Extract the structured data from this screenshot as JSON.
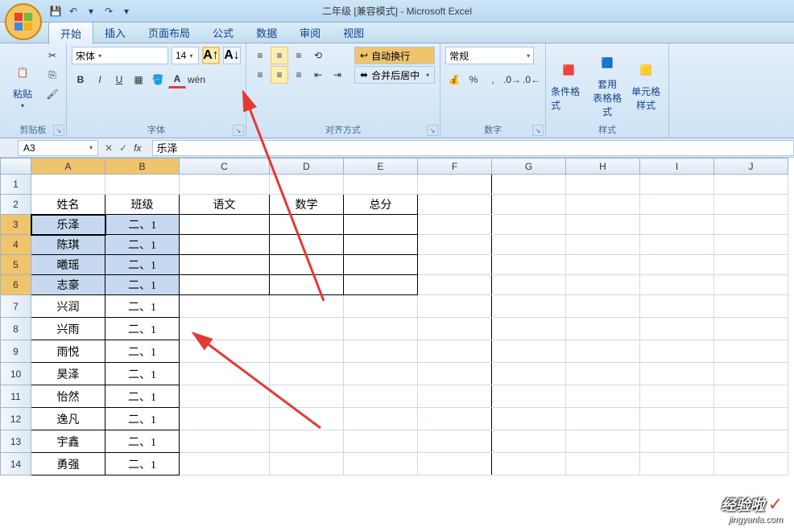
{
  "title": "二年级  [兼容模式] - Microsoft Excel",
  "tabs": {
    "start": "开始",
    "insert": "插入",
    "layout": "页面布局",
    "formula": "公式",
    "data": "数据",
    "review": "审阅",
    "view": "视图"
  },
  "ribbon": {
    "clipboard": {
      "paste": "粘贴",
      "label": "剪贴板"
    },
    "font": {
      "name": "宋体",
      "size": "14",
      "label": "字体"
    },
    "align": {
      "wrap": "自动换行",
      "merge": "合并后居中",
      "label": "对齐方式"
    },
    "number": {
      "format": "常规",
      "label": "数字"
    },
    "styles": {
      "cond": "条件格式",
      "table": "套用\n表格格式",
      "cell": "单元格\n样式",
      "label": "样式"
    }
  },
  "namebox": "A3",
  "formula": "乐泽",
  "cols": [
    "A",
    "B",
    "C",
    "D",
    "E",
    "F",
    "G",
    "H",
    "I",
    "J"
  ],
  "headers": {
    "name": "姓名",
    "class": "班级",
    "chinese": "语文",
    "math": "数学",
    "total": "总分"
  },
  "rows": [
    {
      "n": 3,
      "name": "乐泽",
      "class": "二、1"
    },
    {
      "n": 4,
      "name": "陈琪",
      "class": "二、1"
    },
    {
      "n": 5,
      "name": "曦瑶",
      "class": "二、1"
    },
    {
      "n": 6,
      "name": "志豪",
      "class": "二、1"
    },
    {
      "n": 7,
      "name": "兴润",
      "class": "二、1"
    },
    {
      "n": 8,
      "name": "兴雨",
      "class": "二、1"
    },
    {
      "n": 9,
      "name": "雨悦",
      "class": "二、1"
    },
    {
      "n": 10,
      "name": "昊泽",
      "class": "二、1"
    },
    {
      "n": 11,
      "name": "怡然",
      "class": "二、1"
    },
    {
      "n": 12,
      "name": "逸凡",
      "class": "二、1"
    },
    {
      "n": 13,
      "name": "宇鑫",
      "class": "二、1"
    },
    {
      "n": 14,
      "name": "勇强",
      "class": "二、1"
    }
  ],
  "watermark": {
    "t1": "经验啦",
    "t2": "jingyanla.com"
  }
}
